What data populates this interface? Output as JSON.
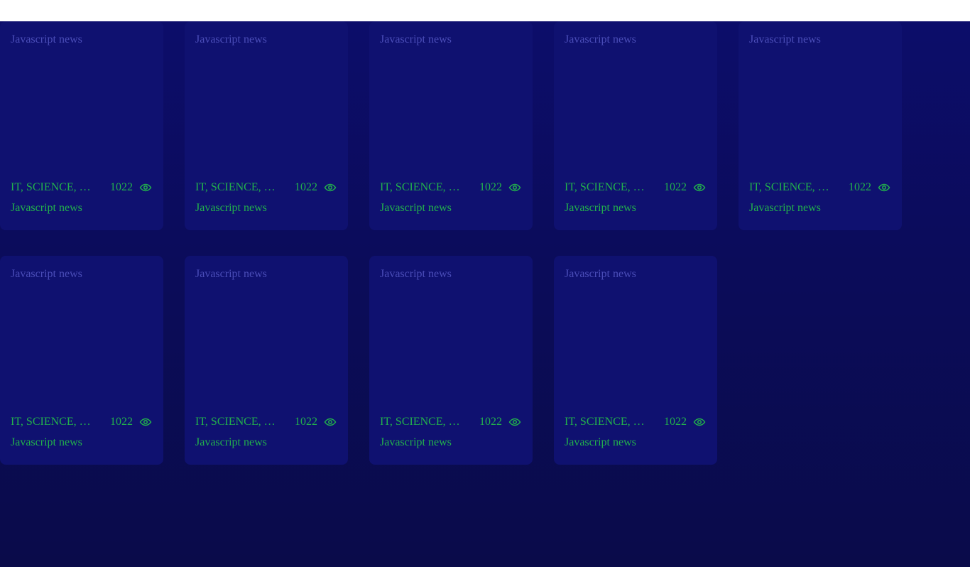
{
  "cards": [
    {
      "image_alt": "Javascript news",
      "tags": "IT, SCIENCE, …",
      "views": "1022",
      "title": "Javascript news"
    },
    {
      "image_alt": "Javascript news",
      "tags": "IT, SCIENCE, …",
      "views": "1022",
      "title": "Javascript news"
    },
    {
      "image_alt": "Javascript news",
      "tags": "IT, SCIENCE, …",
      "views": "1022",
      "title": "Javascript news"
    },
    {
      "image_alt": "Javascript news",
      "tags": "IT, SCIENCE, …",
      "views": "1022",
      "title": "Javascript news"
    },
    {
      "image_alt": "Javascript news",
      "tags": "IT, SCIENCE, …",
      "views": "1022",
      "title": "Javascript news"
    },
    {
      "image_alt": "Javascript news",
      "tags": "IT, SCIENCE, …",
      "views": "1022",
      "title": "Javascript news"
    },
    {
      "image_alt": "Javascript news",
      "tags": "IT, SCIENCE, …",
      "views": "1022",
      "title": "Javascript news"
    },
    {
      "image_alt": "Javascript news",
      "tags": "IT, SCIENCE, …",
      "views": "1022",
      "title": "Javascript news"
    },
    {
      "image_alt": "Javascript news",
      "tags": "IT, SCIENCE, …",
      "views": "1022",
      "title": "Javascript news"
    }
  ],
  "icons": {
    "views": "eye-icon"
  },
  "colors": {
    "accent_text": "#22b14c",
    "card_bg": "#0f1170",
    "page_bg": "#0b0c5a"
  }
}
